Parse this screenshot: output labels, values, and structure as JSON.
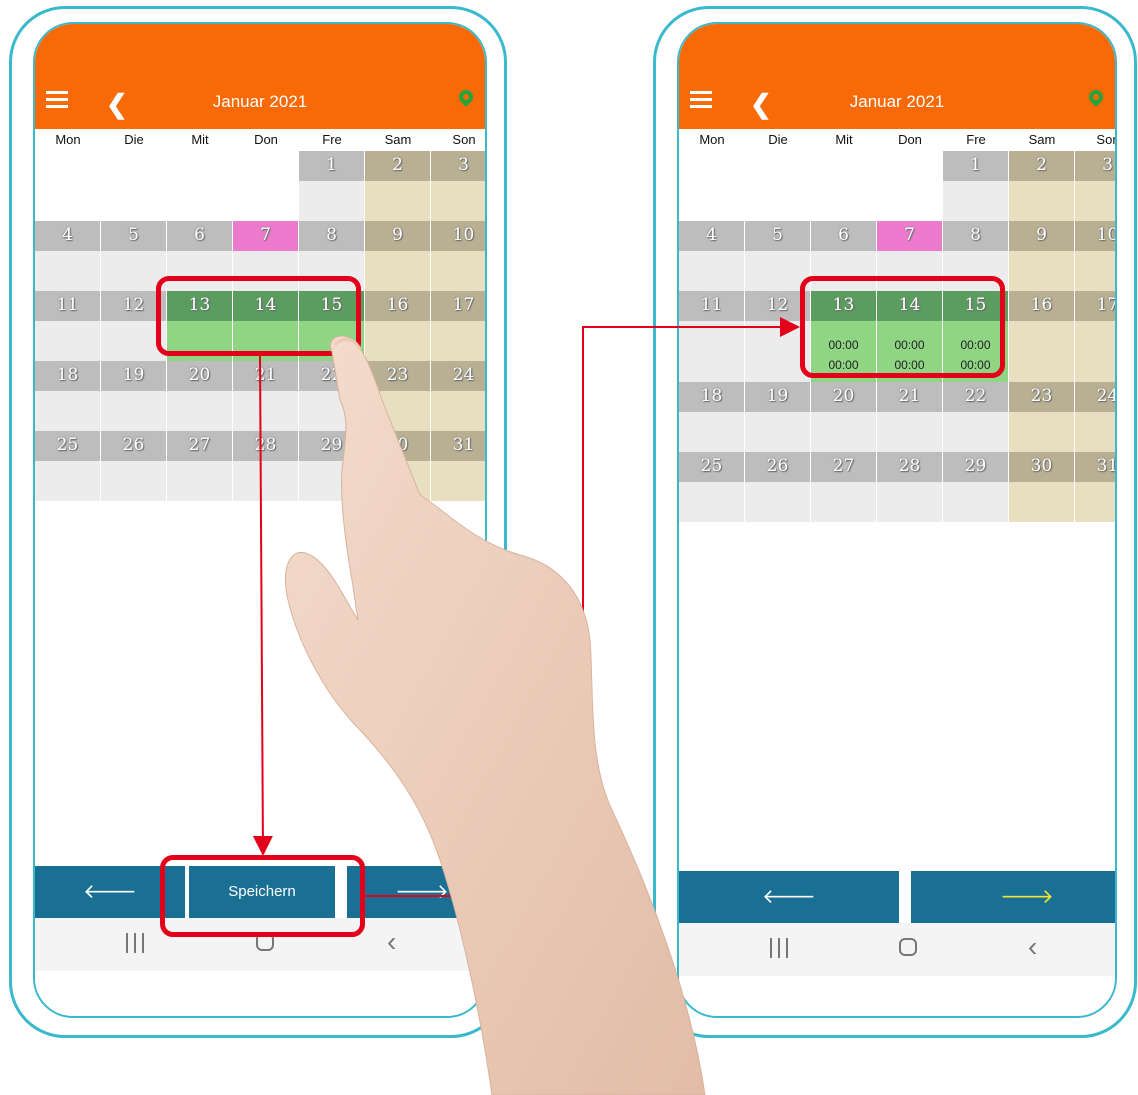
{
  "calendar": {
    "title": "Januar 2021",
    "weekdays": [
      "Mon",
      "Die",
      "Mit",
      "Don",
      "Fre",
      "Sam",
      "Son"
    ],
    "weeks": [
      [
        "",
        "",
        "",
        "",
        "1",
        "2",
        "3"
      ],
      [
        "4",
        "5",
        "6",
        "7",
        "8",
        "9",
        "10"
      ],
      [
        "11",
        "12",
        "13",
        "14",
        "15",
        "16",
        "17"
      ],
      [
        "18",
        "19",
        "20",
        "21",
        "22",
        "23",
        "24"
      ],
      [
        "25",
        "26",
        "27",
        "28",
        "29",
        "30",
        "31"
      ]
    ],
    "today": "7",
    "selected_days": [
      "13",
      "14",
      "15"
    ],
    "selected_times": {
      "start": "00:00",
      "end": "00:00"
    }
  },
  "left_screen": {
    "bottom": {
      "prev_label": "🡐",
      "save_label": "Speichern",
      "next_label": "🡒"
    }
  },
  "right_screen": {
    "bottom": {
      "prev_label": "🡐",
      "next_label": "🡒"
    }
  },
  "navbar": {
    "back_glyph": "‹"
  },
  "colors": {
    "app_bar": "#f86a07",
    "phone_outline": "#39b9cc",
    "button_bar": "#1a6f94",
    "selected_day": "#5a9d5f",
    "selected_day_body": "#8fd584",
    "today": "#ec7bcd",
    "weekend": "#b9b093",
    "highlight": "#e3001b",
    "next_arrow_active": "#f2e633"
  },
  "icons": [
    "menu-icon",
    "back-chevron-icon",
    "location-pin-icon",
    "arrow-left-icon",
    "arrow-right-icon",
    "recents-icon",
    "home-icon",
    "nav-back-icon"
  ]
}
